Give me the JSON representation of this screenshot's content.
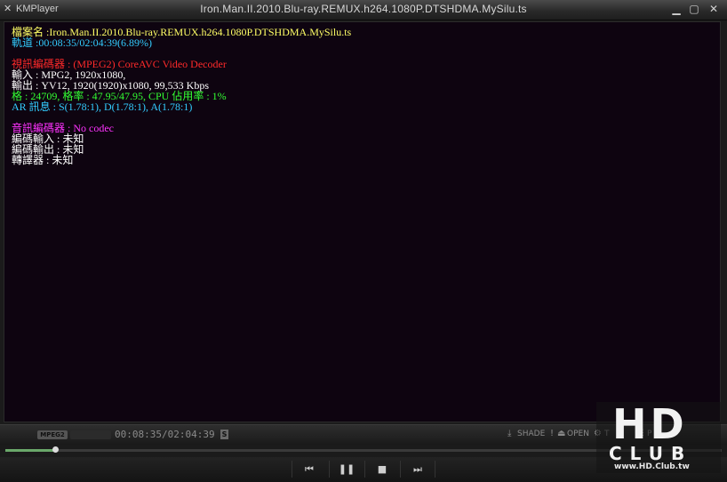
{
  "window": {
    "app_name": "KMPlayer",
    "title": "Iron.Man.II.2010.Blu-ray.REMUX.h264.1080P.DTSHDMA.MySilu.ts",
    "icons": [
      "kmplayer-logo-icon",
      "minimize-icon",
      "maximize-icon",
      "close-icon"
    ]
  },
  "osd": {
    "lines": [
      {
        "text": "檔案名 :Iron.Man.II.2010.Blu-ray.REMUX.h264.1080P.DTSHDMA.MySilu.ts",
        "color": "#ffff66"
      },
      {
        "text": "軌道 :00:08:35/02:04:39(6.89%)",
        "color": "#33ccff"
      },
      {
        "text": "",
        "color": "#ffffff"
      },
      {
        "text": "視訊編碼器 : (MPEG2) CoreAVC Video Decoder",
        "color": "#ff2a2a"
      },
      {
        "text": "輸入 : MPG2, 1920x1080,",
        "color": "#ffffff"
      },
      {
        "text": "輸出 : YV12, 1920(1920)x1080, 99,533 Kbps",
        "color": "#ffffff"
      },
      {
        "text": "格 : 24709, 格率 : 47.95/47.95, CPU 佔用率 : 1%",
        "color": "#33ff33"
      },
      {
        "text": "AR 訊息 : S(1.78:1), D(1.78:1), A(1.78:1)",
        "color": "#33ccff"
      },
      {
        "text": "",
        "color": "#ffffff"
      },
      {
        "text": "音訊編碼器 : No codec",
        "color": "#ff33ff"
      },
      {
        "text": "編碼輸入 : 未知",
        "color": "#ffffff"
      },
      {
        "text": "編碼輸出 : 未知",
        "color": "#ffffff"
      },
      {
        "text": "轉譯器 : 未知",
        "color": "#ffffff"
      }
    ]
  },
  "statusbar": {
    "codec_badge": "MPEG2",
    "time": "00:08:35/02:04:39",
    "s_badge": "S",
    "shade_label": "SHADE",
    "open_label": "OPEN",
    "settings_partial": "T",
    "playlist_partial": "P"
  },
  "seek": {
    "progress_fraction": 0.0689
  },
  "controls": {
    "buttons": [
      "prev-icon",
      "pause-icon",
      "stop-icon",
      "next-icon"
    ]
  },
  "watermark": {
    "logo": "HD",
    "club": "CLUB",
    "url": "www.HD.Club.tw"
  }
}
